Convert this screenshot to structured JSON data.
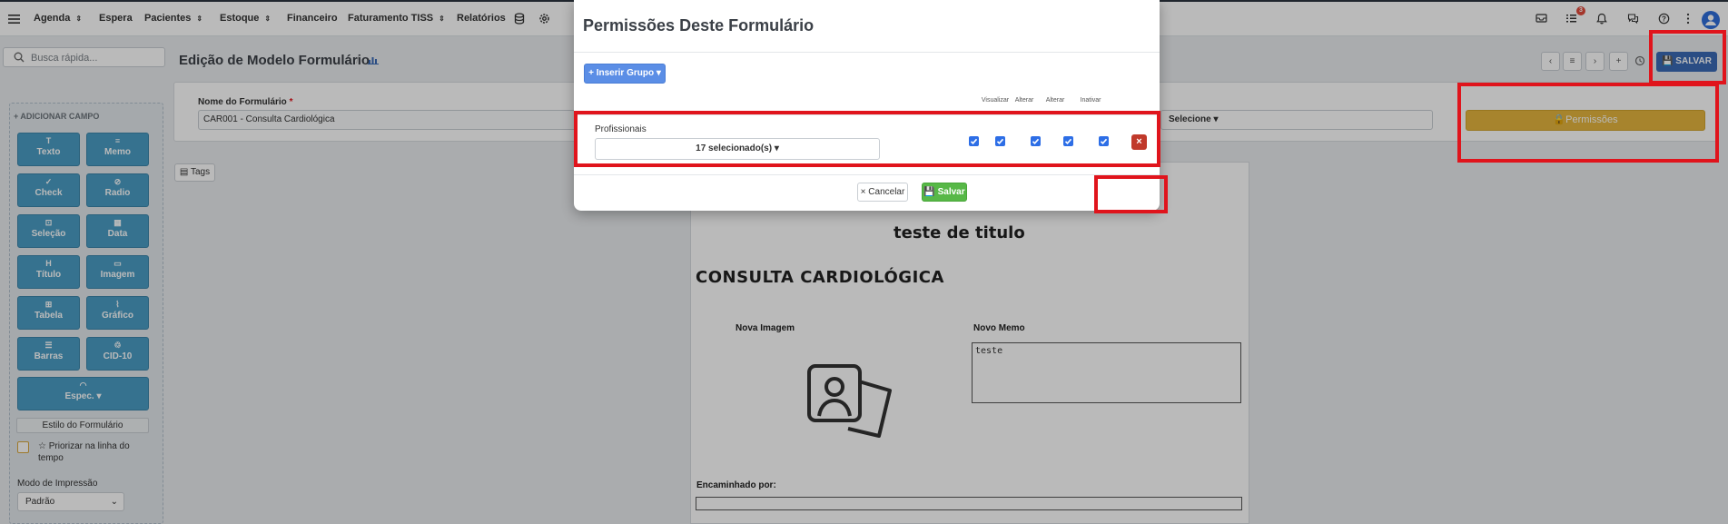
{
  "topbar": {
    "nav": [
      {
        "label": "Agenda",
        "has_sort": true
      },
      {
        "label": "Espera",
        "has_sort": false
      },
      {
        "label": "Pacientes",
        "has_sort": true
      },
      {
        "label": "Estoque",
        "has_sort": true
      },
      {
        "label": "Financeiro",
        "has_sort": false
      },
      {
        "label": "Faturamento TISS",
        "has_sort": true
      },
      {
        "label": "Relatórios",
        "has_sort": false
      }
    ],
    "notification_count": "3",
    "icons": [
      "database-icon",
      "settings-icon",
      "mail-icon",
      "tasks-icon",
      "bell-icon",
      "chat-icon",
      "help-icon",
      "more-icon",
      "user-avatar-icon"
    ]
  },
  "search": {
    "placeholder": "Busca rápida..."
  },
  "header": {
    "title": "Edição de Modelo Formulário",
    "buttons": [
      "‹",
      "≡",
      "›",
      "+"
    ],
    "save_label": "SALVAR"
  },
  "left_panel": {
    "title": "+ ADICIONAR CAMPO",
    "tiles": [
      {
        "label": "Texto",
        "icon": "T"
      },
      {
        "label": "Memo",
        "icon": "≡"
      },
      {
        "label": "Check",
        "icon": ""
      },
      {
        "label": "Radio",
        "icon": "⊘"
      },
      {
        "label": "Seleção",
        "icon": "⊡"
      },
      {
        "label": "Data",
        "icon": "▦"
      },
      {
        "label": "Título",
        "icon": "H"
      },
      {
        "label": "Imagem",
        "icon": "▭"
      },
      {
        "label": "Tabela",
        "icon": "⊞"
      },
      {
        "label": "Gráfico",
        "icon": "⌇"
      },
      {
        "label": "Barras",
        "icon": "☰"
      },
      {
        "label": "CID-10",
        "icon": "♲"
      },
      {
        "label": "Espec. ▾",
        "icon": "◠"
      }
    ],
    "style_button": "Estilo do Formulário",
    "prioritize_label": "☆ Priorizar na linha do tempo",
    "print_mode_label": "Modo de Impressão",
    "print_mode_value": "Padrão"
  },
  "form": {
    "name_label": "Nome do Formulário",
    "name_required": "*",
    "name_value": "CAR001 - Consulta Cardiológica",
    "select_value": "Selecione",
    "permissions_label": "Permissões"
  },
  "tags_label": "Tags",
  "canvas": {
    "title": "teste de titulo",
    "heading": "CONSULTA CARDIOLÓGICA",
    "image_label": "Nova Imagem",
    "memo_label": "Novo Memo",
    "memo_value": "teste",
    "forward_label": "Encaminhado por:"
  },
  "modal": {
    "title": "Permissões Deste Formulário",
    "insert_group": "+ Inserir Grupo ▾",
    "column_headers": [
      "Visualizar",
      "Alterar",
      "Alterar",
      "Inativar"
    ],
    "row_label": "Profissionais",
    "selected_text": "17 selecionado(s) ▾",
    "checkboxes": [
      true,
      true,
      true,
      true,
      true
    ],
    "cancel": "× Cancelar",
    "save": "Salvar"
  },
  "colors": {
    "brand_blue": "#3a6ab5",
    "tile_blue": "#4a9dc4",
    "permissions_yellow": "#e5b63e",
    "save_green": "#57b847",
    "highlight_red": "#e0141c"
  }
}
